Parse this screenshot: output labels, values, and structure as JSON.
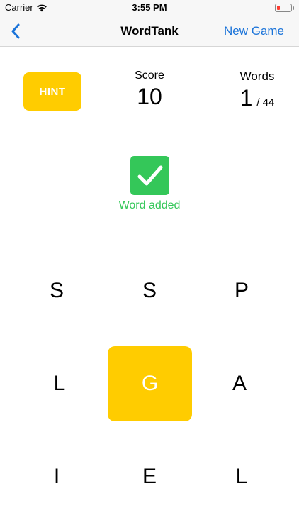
{
  "status_bar": {
    "carrier": "Carrier",
    "time": "3:55 PM",
    "battery_level": 0.2
  },
  "nav": {
    "title": "WordTank",
    "new_game": "New Game"
  },
  "hint": {
    "label": "HINT"
  },
  "score": {
    "label": "Score",
    "value": "10"
  },
  "words": {
    "label": "Words",
    "found": "1",
    "total": "/ 44"
  },
  "feedback": {
    "message": "Word added"
  },
  "grid": {
    "letters": [
      "S",
      "S",
      "P",
      "L",
      "G",
      "A",
      "I",
      "E",
      "L"
    ],
    "selected_letter": "G"
  },
  "colors": {
    "accent_yellow": "#ffcc00",
    "success_green": "#34c759",
    "link_blue": "#1a73d9"
  }
}
